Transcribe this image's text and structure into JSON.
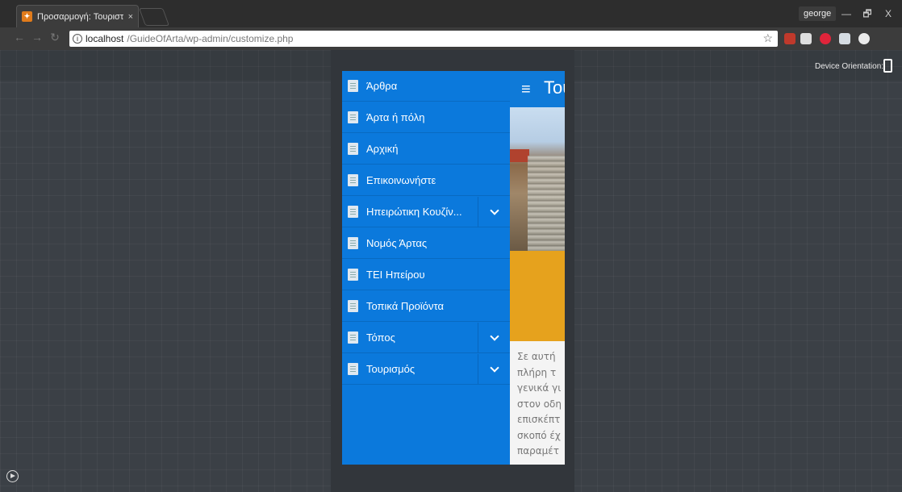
{
  "browser": {
    "tab_title": "Προσαρμογή: Τουριστικ",
    "tab_close": "×",
    "user": "george",
    "url_host": "localhost",
    "url_path": "/GuideOfArta/wp-admin/customize.php",
    "minimize": "—",
    "restore": "🗗",
    "close": "X"
  },
  "customizer": {
    "orientation_label": "Device Orientation:"
  },
  "site": {
    "title": "Του",
    "hamburger": "≡",
    "paragraph": [
      "Σε αυτή",
      "πλήρη τ",
      "γενικά γι",
      "στον οδη",
      "επισκέπτ",
      "σκοπό έχ",
      "παραμέτ"
    ]
  },
  "menu": {
    "items": [
      {
        "label": "Άρθρα",
        "has_submenu": false
      },
      {
        "label": "Άρτα ή πόλη",
        "has_submenu": false
      },
      {
        "label": "Αρχική",
        "has_submenu": false
      },
      {
        "label": "Επικοινωνήστε",
        "has_submenu": false
      },
      {
        "label": "Ηπειρώτικη Κουζίν...",
        "has_submenu": true
      },
      {
        "label": "Νομός Άρτας",
        "has_submenu": false
      },
      {
        "label": "ΤΕΙ Ηπείρου",
        "has_submenu": false
      },
      {
        "label": "Τοπικά Προϊόντα",
        "has_submenu": false
      },
      {
        "label": "Τόπος",
        "has_submenu": true
      },
      {
        "label": "Τουρισμός",
        "has_submenu": true
      }
    ]
  },
  "colors": {
    "drawer_blue": "#0b79dc",
    "accent_yellow": "#e6a21d",
    "canvas_bg": "#3b4046"
  }
}
